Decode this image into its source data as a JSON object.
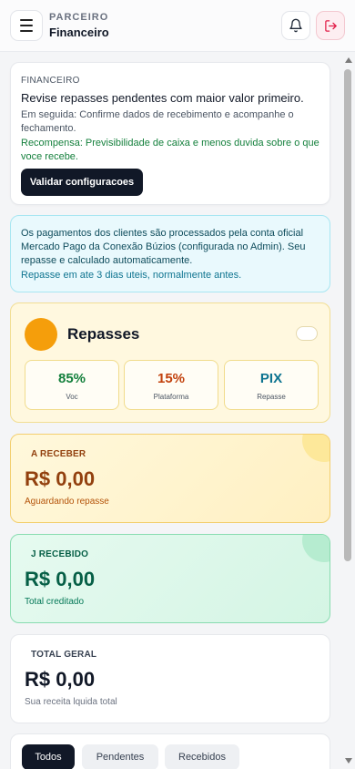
{
  "header": {
    "eyebrow": "PARCEIRO",
    "title": "Financeiro"
  },
  "info": {
    "eyebrow": "FINANCEIRO",
    "title": "Revise repasses pendentes com maior valor primeiro.",
    "subtitle": "Em seguida: Confirme dados de recebimento e acompanhe o fechamento.",
    "reward": "Recompensa: Previsibilidade de caixa e menos duvida sobre o que voce recebe.",
    "button_label": "Validar configuracoes"
  },
  "notice": {
    "text": "Os pagamentos dos clientes são processados pela conta oficial Mercado Pago da Conexão Búzios (configurada no Admin). Seu repasse e calculado automaticamente.",
    "highlight": "Repasse em ate 3 dias uteis, normalmente antes."
  },
  "repasses": {
    "title": "Repasses",
    "toggle_on": false,
    "stats": [
      {
        "value": "85%",
        "label": "Voc",
        "color": "#15803d"
      },
      {
        "value": "15%",
        "label": "Plataforma",
        "color": "#c2410c"
      },
      {
        "value": "PIX",
        "label": "Repasse",
        "color": "#0e7490"
      }
    ]
  },
  "summary": {
    "a_receber": {
      "label": "A RECEBER",
      "value": "R$ 0,00",
      "sub": "Aguardando repasse"
    },
    "recebido": {
      "label": "J RECEBIDO",
      "value": "R$ 0,00",
      "sub": "Total creditado"
    },
    "total": {
      "label": "TOTAL GERAL",
      "value": "R$ 0,00",
      "sub": "Sua receita lquida total"
    }
  },
  "tabs": [
    {
      "label": "Todos",
      "active": true
    },
    {
      "label": "Pendentes",
      "active": false
    },
    {
      "label": "Recebidos",
      "active": false
    }
  ],
  "colors": {
    "accent_dark": "#111827",
    "amber": "#f59e0b",
    "green": "#15803d",
    "cyan": "#0e7490"
  },
  "icons": {
    "menu": "hamburger-menu-icon",
    "bell": "bell-icon",
    "logout": "logout-icon"
  }
}
